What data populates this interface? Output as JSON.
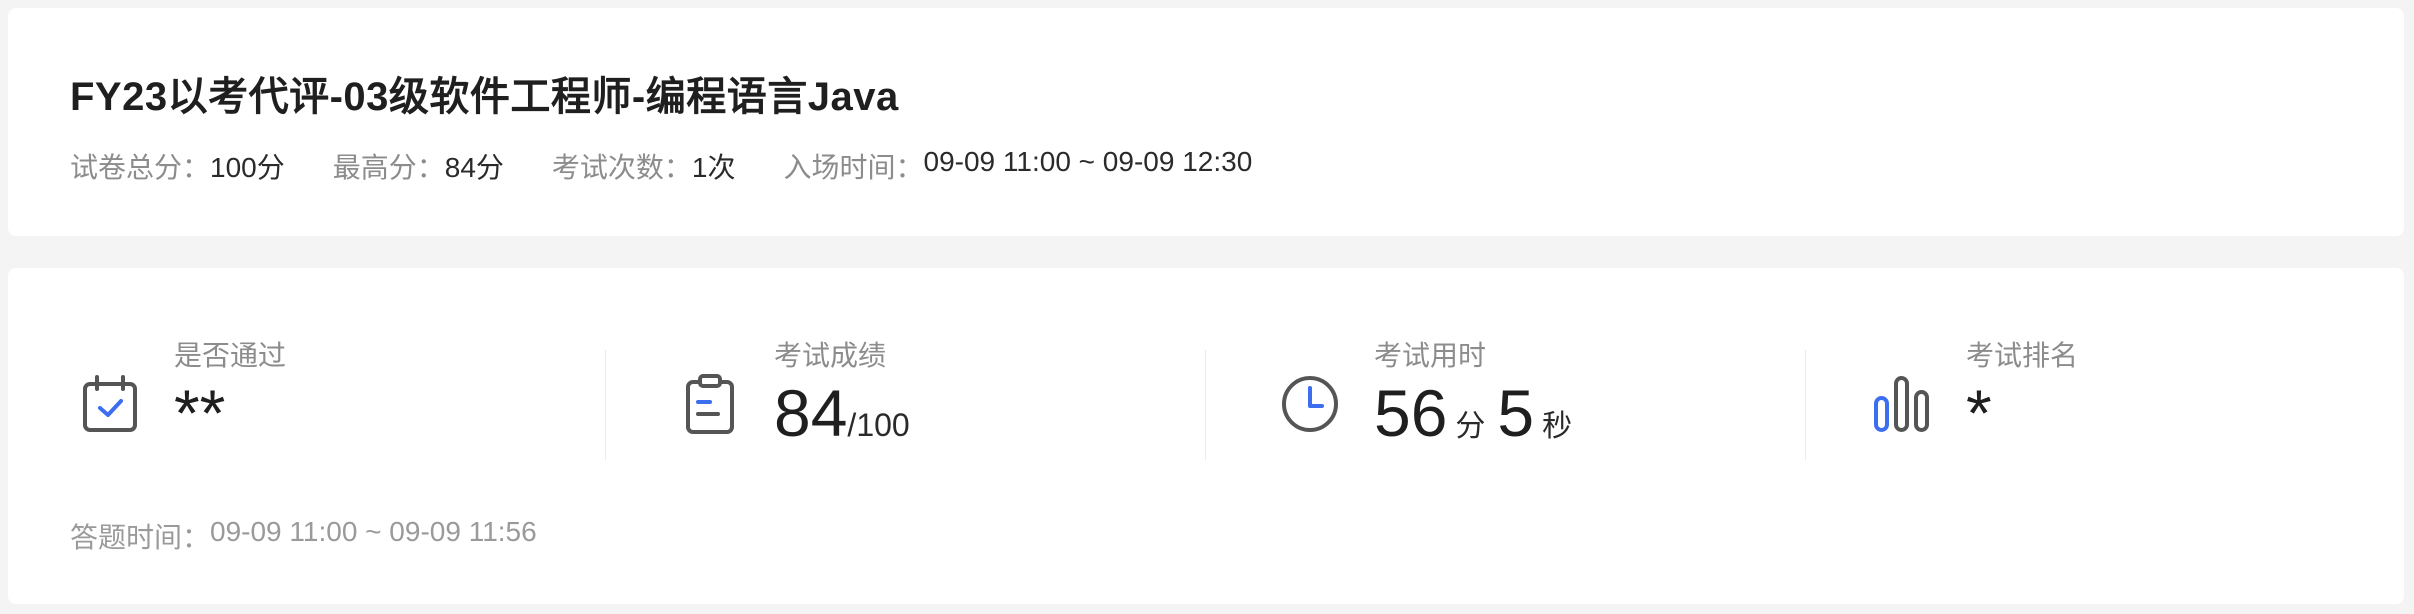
{
  "exam": {
    "title": "FY23以考代评-03级软件工程师-编程语言Java",
    "meta": [
      {
        "label": "试卷总分：",
        "value": "100分"
      },
      {
        "label": "最高分：",
        "value": "84分"
      },
      {
        "label": "考试次数：",
        "value": "1次"
      },
      {
        "label": "入场时间：",
        "value": "09-09 11:00 ~ 09-09 12:30"
      }
    ]
  },
  "stats": {
    "passed": {
      "label": "是否通过",
      "value": "**",
      "icon": "calendar-check-icon"
    },
    "score": {
      "label": "考试成绩",
      "value": "84",
      "total": "/100",
      "icon": "clipboard-icon"
    },
    "duration": {
      "label": "考试用时",
      "minutes": "56",
      "minutes_unit": "分",
      "seconds": "5",
      "seconds_unit": "秒",
      "icon": "clock-icon"
    },
    "rank": {
      "label": "考试排名",
      "value": "*",
      "icon": "bar-chart-icon"
    }
  },
  "answer_time": {
    "label": "答题时间：",
    "value": "09-09 11:00 ~ 09-09 11:56"
  },
  "colors": {
    "accent": "#3d6ef0",
    "icon_stroke": "#555555",
    "muted_text": "#8c8c8c",
    "background": "#f4f4f5",
    "card": "#ffffff"
  }
}
